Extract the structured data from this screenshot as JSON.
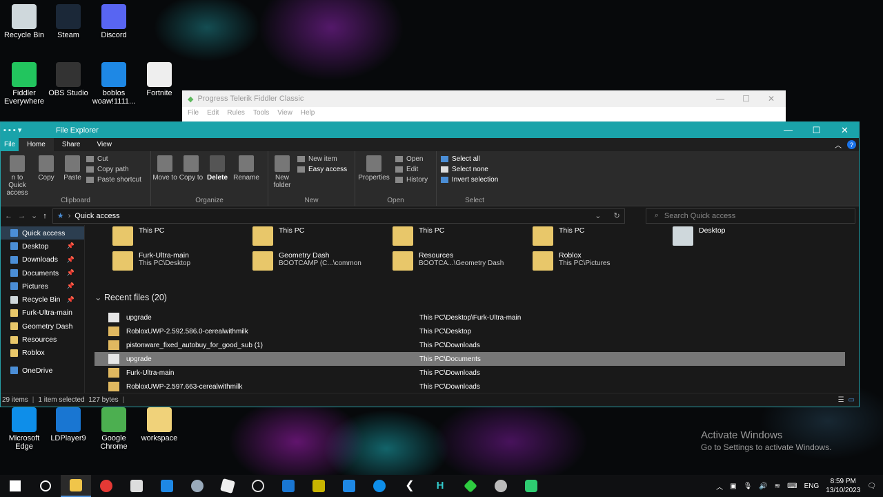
{
  "desktop": {
    "icons": [
      {
        "label": "Recycle Bin",
        "color": "#cfd8dc"
      },
      {
        "label": "Steam",
        "color": "#1b2838"
      },
      {
        "label": "Discord",
        "color": "#5865f2"
      },
      {
        "label": "Fiddler Everywhere",
        "color": "#22c55e"
      },
      {
        "label": "OBS Studio",
        "color": "#333333"
      },
      {
        "label": "boblos woaw!1111...",
        "color": "#1e88e5"
      },
      {
        "label": "Fortnite",
        "color": "#eeeeee"
      },
      {
        "label": "Microsoft Edge",
        "color": "#0e8ee9"
      },
      {
        "label": "LDPlayer9",
        "color": "#1976d2"
      },
      {
        "label": "Google Chrome",
        "color": "#4caf50"
      },
      {
        "label": "workspace",
        "color": "#f0d27a"
      }
    ]
  },
  "fiddler": {
    "title": "Progress Telerik Fiddler Classic",
    "menu": [
      "File",
      "Edit",
      "Rules",
      "Tools",
      "View",
      "Help"
    ]
  },
  "explorer": {
    "title": "File Explorer",
    "tabs": [
      "File",
      "Home",
      "Share",
      "View"
    ],
    "ribbon": {
      "clipboard": {
        "name": "Clipboard",
        "pin": "n to Quick access",
        "copy": "Copy",
        "paste": "Paste",
        "cut": "Cut",
        "copy_path": "Copy path",
        "paste_shortcut": "Paste shortcut"
      },
      "organize": {
        "name": "Organize",
        "move": "Move to",
        "copy": "Copy to",
        "delete": "Delete",
        "rename": "Rename"
      },
      "new": {
        "name": "New",
        "folder": "New folder",
        "item": "New item",
        "easy": "Easy access"
      },
      "open": {
        "name": "Open",
        "properties": "Properties",
        "open": "Open",
        "edit": "Edit",
        "history": "History"
      },
      "select": {
        "name": "Select",
        "all": "Select all",
        "none": "Select none",
        "invert": "Invert selection"
      }
    },
    "address": "Quick access",
    "search_placeholder": "Search Quick access",
    "nav": [
      {
        "label": "Quick access",
        "sel": true
      },
      {
        "label": "Desktop",
        "pin": true
      },
      {
        "label": "Downloads",
        "pin": true
      },
      {
        "label": "Documents",
        "pin": true
      },
      {
        "label": "Pictures",
        "pin": true
      },
      {
        "label": "Recycle Bin",
        "pin": true
      },
      {
        "label": "Furk-Ultra-main"
      },
      {
        "label": "Geometry Dash"
      },
      {
        "label": "Resources"
      },
      {
        "label": "Roblox"
      },
      {
        "label": "OneDrive"
      }
    ],
    "frequent": [
      {
        "name": "This PC",
        "path": ""
      },
      {
        "name": "This PC",
        "path": ""
      },
      {
        "name": "This PC",
        "path": ""
      },
      {
        "name": "This PC",
        "path": ""
      },
      {
        "name": "Desktop",
        "path": ""
      },
      {
        "name": "Furk-Ultra-main",
        "path": "This PC\\Desktop"
      },
      {
        "name": "Geometry Dash",
        "path": "BOOTCAMP (C...\\common"
      },
      {
        "name": "Resources",
        "path": "BOOTCA...\\Geometry Dash"
      },
      {
        "name": "Roblox",
        "path": "This PC\\Pictures"
      }
    ],
    "recent_header": "Recent files (20)",
    "recent": [
      {
        "name": "upgrade",
        "path": "This PC\\Desktop\\Furk-Ultra-main"
      },
      {
        "name": "RobloxUWP-2.592.586.0-cerealwithmilk",
        "path": "This PC\\Desktop"
      },
      {
        "name": "pistonware_fixed_autobuy_for_good_sub (1)",
        "path": "This PC\\Downloads"
      },
      {
        "name": "upgrade",
        "path": "This PC\\Documents",
        "sel": true
      },
      {
        "name": "Furk-Ultra-main",
        "path": "This PC\\Downloads"
      },
      {
        "name": "RobloxUWP-2.597.663-cerealwithmilk",
        "path": "This PC\\Downloads"
      }
    ],
    "status": {
      "items": "29 items",
      "selected": "1 item selected  127 bytes"
    }
  },
  "taskbar": {
    "lang": "ENG",
    "time": "8:59 PM",
    "date": "13/10/2023"
  },
  "watermark": {
    "line1": "Activate Windows",
    "line2": "Go to Settings to activate Windows."
  }
}
